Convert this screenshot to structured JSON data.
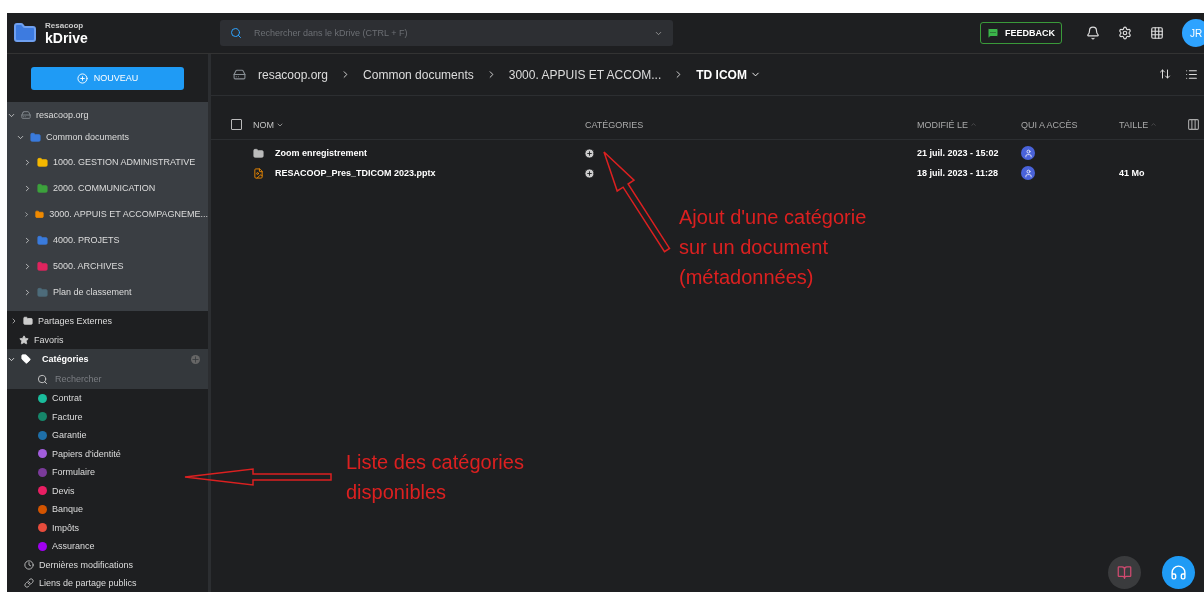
{
  "header": {
    "brand_small": "Resacoop",
    "brand": "kDrive",
    "search": {
      "placeholder": "Rechercher dans le kDrive (CTRL + F)"
    },
    "feedback": "FEEDBACK",
    "avatar": "JR"
  },
  "sidebar": {
    "new_button": "NOUVEAU",
    "tree": [
      {
        "label": "resacoop.org",
        "kind": "drive",
        "expanded": true,
        "children": [
          {
            "label": "Common documents",
            "kind": "folder",
            "color": "#3a7bdc",
            "expanded": true,
            "children": [
              {
                "label": "1000. GESTION ADMINISTRATIVE",
                "kind": "folder",
                "color": "#f5b800",
                "expanded": false
              },
              {
                "label": "2000. COMMUNICATION",
                "kind": "folder",
                "color": "#3ca13c",
                "expanded": false
              },
              {
                "label": "3000. APPUIS ET ACCOMPAGNEME...",
                "kind": "folder",
                "color": "#f08a00",
                "expanded": false
              },
              {
                "label": "4000. PROJETS",
                "kind": "folder",
                "color": "#3a7bdc",
                "expanded": false
              },
              {
                "label": "5000. ARCHIVES",
                "kind": "folder",
                "color": "#e0245e",
                "expanded": false
              },
              {
                "label": "Plan de classement",
                "kind": "folder",
                "color": "#4d6b7a",
                "expanded": false
              }
            ]
          }
        ]
      }
    ],
    "nav": [
      {
        "label": "Partages Externes",
        "kind": "shares"
      },
      {
        "label": "Favoris",
        "kind": "star"
      }
    ],
    "categories": {
      "label": "Catégories",
      "expanded": true,
      "search_placeholder": "Rechercher",
      "items": [
        {
          "name": "Contrat",
          "color": "#1abc9c"
        },
        {
          "name": "Facture",
          "color": "#16866a"
        },
        {
          "name": "Garantie",
          "color": "#1e6fa8"
        },
        {
          "name": "Papiers d'identité",
          "color": "#a25ddc"
        },
        {
          "name": "Formulaire",
          "color": "#7a3a9a"
        },
        {
          "name": "Devis",
          "color": "#e91e63"
        },
        {
          "name": "Banque",
          "color": "#d35400"
        },
        {
          "name": "Impôts",
          "color": "#e74c3c"
        },
        {
          "name": "Assurance",
          "color": "#a000f0"
        }
      ]
    },
    "bottom_nav": [
      {
        "label": "Dernières modifications",
        "kind": "clock"
      },
      {
        "label": "Liens de partage publics",
        "kind": "link"
      }
    ]
  },
  "main": {
    "breadcrumb": [
      "resacoop.org",
      "Common documents",
      "3000. APPUIS ET ACCOM..."
    ],
    "current": "TD ICOM",
    "select_all": {
      "checked": false
    },
    "columns": [
      {
        "label": "NOM",
        "sorted": true,
        "sortable": true
      },
      {
        "label": "CATÉGORIES",
        "sorted": false,
        "sortable": false
      },
      {
        "label": "MODIFIÉ LE",
        "sorted": false,
        "sortable": true
      },
      {
        "label": "QUI A ACCÈS",
        "sorted": false,
        "sortable": false
      },
      {
        "label": "TAILLE",
        "sorted": false,
        "sortable": true
      }
    ],
    "rows": [
      {
        "name": "Zoom enregistrement",
        "kind": "folder",
        "modified": "21 juil. 2023 - 15:02"
      },
      {
        "name": "RESACOOP_Pres_TDICOM 2023.pptx",
        "kind": "pptx",
        "modified": "18 juil. 2023 - 11:28",
        "size": "41 Mo"
      }
    ]
  },
  "annotations": [
    {
      "text": "Ajout d'une catégorie\nsur un document\n(métadonnées)",
      "kind": "up-left"
    },
    {
      "text": "Liste des catégories\ndisponibles",
      "kind": "left"
    }
  ]
}
